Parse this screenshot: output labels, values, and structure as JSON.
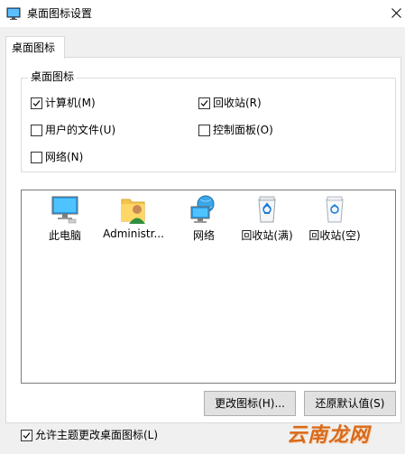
{
  "window": {
    "title": "桌面图标设置"
  },
  "tabs": [
    {
      "label": "桌面图标"
    }
  ],
  "group": {
    "legend": "桌面图标",
    "checkboxes": [
      {
        "label": "计算机(M)",
        "checked": true
      },
      {
        "label": "回收站(R)",
        "checked": true
      },
      {
        "label": "用户的文件(U)",
        "checked": false
      },
      {
        "label": "控制面板(O)",
        "checked": false
      },
      {
        "label": "网络(N)",
        "checked": false
      }
    ]
  },
  "icons": [
    {
      "label": "此电脑",
      "icon": "computer-icon"
    },
    {
      "label": "Administr...",
      "icon": "user-folder-icon"
    },
    {
      "label": "网络",
      "icon": "network-icon"
    },
    {
      "label": "回收站(满)",
      "icon": "recycle-bin-full-icon"
    },
    {
      "label": "回收站(空)",
      "icon": "recycle-bin-empty-icon"
    }
  ],
  "buttons": {
    "change_icon": "更改图标(H)...",
    "restore_default": "还原默认值(S)"
  },
  "allow_theme": {
    "label": "允许主题更改桌面图标(L)",
    "checked": true
  },
  "watermark": "云南龙网"
}
